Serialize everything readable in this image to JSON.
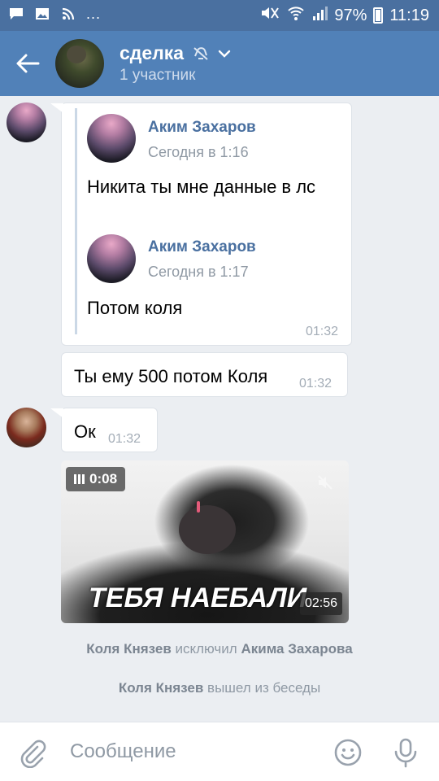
{
  "status_bar": {
    "battery": "97%",
    "time": "11:19",
    "overflow": "..."
  },
  "header": {
    "title": "сделка",
    "subtitle": "1 участник"
  },
  "message_1": {
    "forwarded": [
      {
        "author": "Аким Захаров",
        "time": "Сегодня в 1:16",
        "text": "Никита ты мне данные в лс"
      },
      {
        "author": "Аким Захаров",
        "time": "Сегодня в 1:17",
        "text": "Потом коля"
      }
    ],
    "time": "01:32"
  },
  "message_2": {
    "text": "Ты ему 500 потом Коля",
    "time": "01:32"
  },
  "message_3": {
    "text": "Ок",
    "time": "01:32"
  },
  "video": {
    "duration_badge": "0:08",
    "caption": "ТЕБЯ НАЕБАЛИ",
    "time": "02:56"
  },
  "service_messages": [
    {
      "actor": "Коля Князев",
      "action": "исключил",
      "target": "Акима Захарова"
    },
    {
      "actor": "Коля Князев",
      "action": "вышел из беседы"
    }
  ],
  "composer": {
    "placeholder": "Сообщение"
  },
  "colors": {
    "header": "#5181b8",
    "status_bar": "#4a70a0",
    "background": "#ebeef2",
    "link": "#4a70a0"
  }
}
